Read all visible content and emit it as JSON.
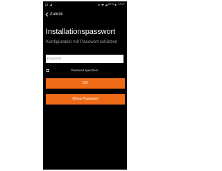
{
  "statusbar": {
    "left_icons": [
      "image-icon",
      "signal-icon"
    ],
    "battery_percent": "81%",
    "time": "13:07"
  },
  "nav": {
    "back_label": "Zurück"
  },
  "header": {
    "title": "Installationspasswort",
    "subtitle": "Konfiguration mit Passwort schützen"
  },
  "form": {
    "password_placeholder": "Passwort",
    "password_value": "",
    "remember_label": "Passwort speichern",
    "remember_checked": false
  },
  "buttons": {
    "ok_label": "OK",
    "no_password_label": "Ohne Passwort"
  },
  "colors": {
    "background": "#000000",
    "accent": "#f06b18",
    "title": "#ffffff",
    "subtitle": "#9e9e9e"
  }
}
